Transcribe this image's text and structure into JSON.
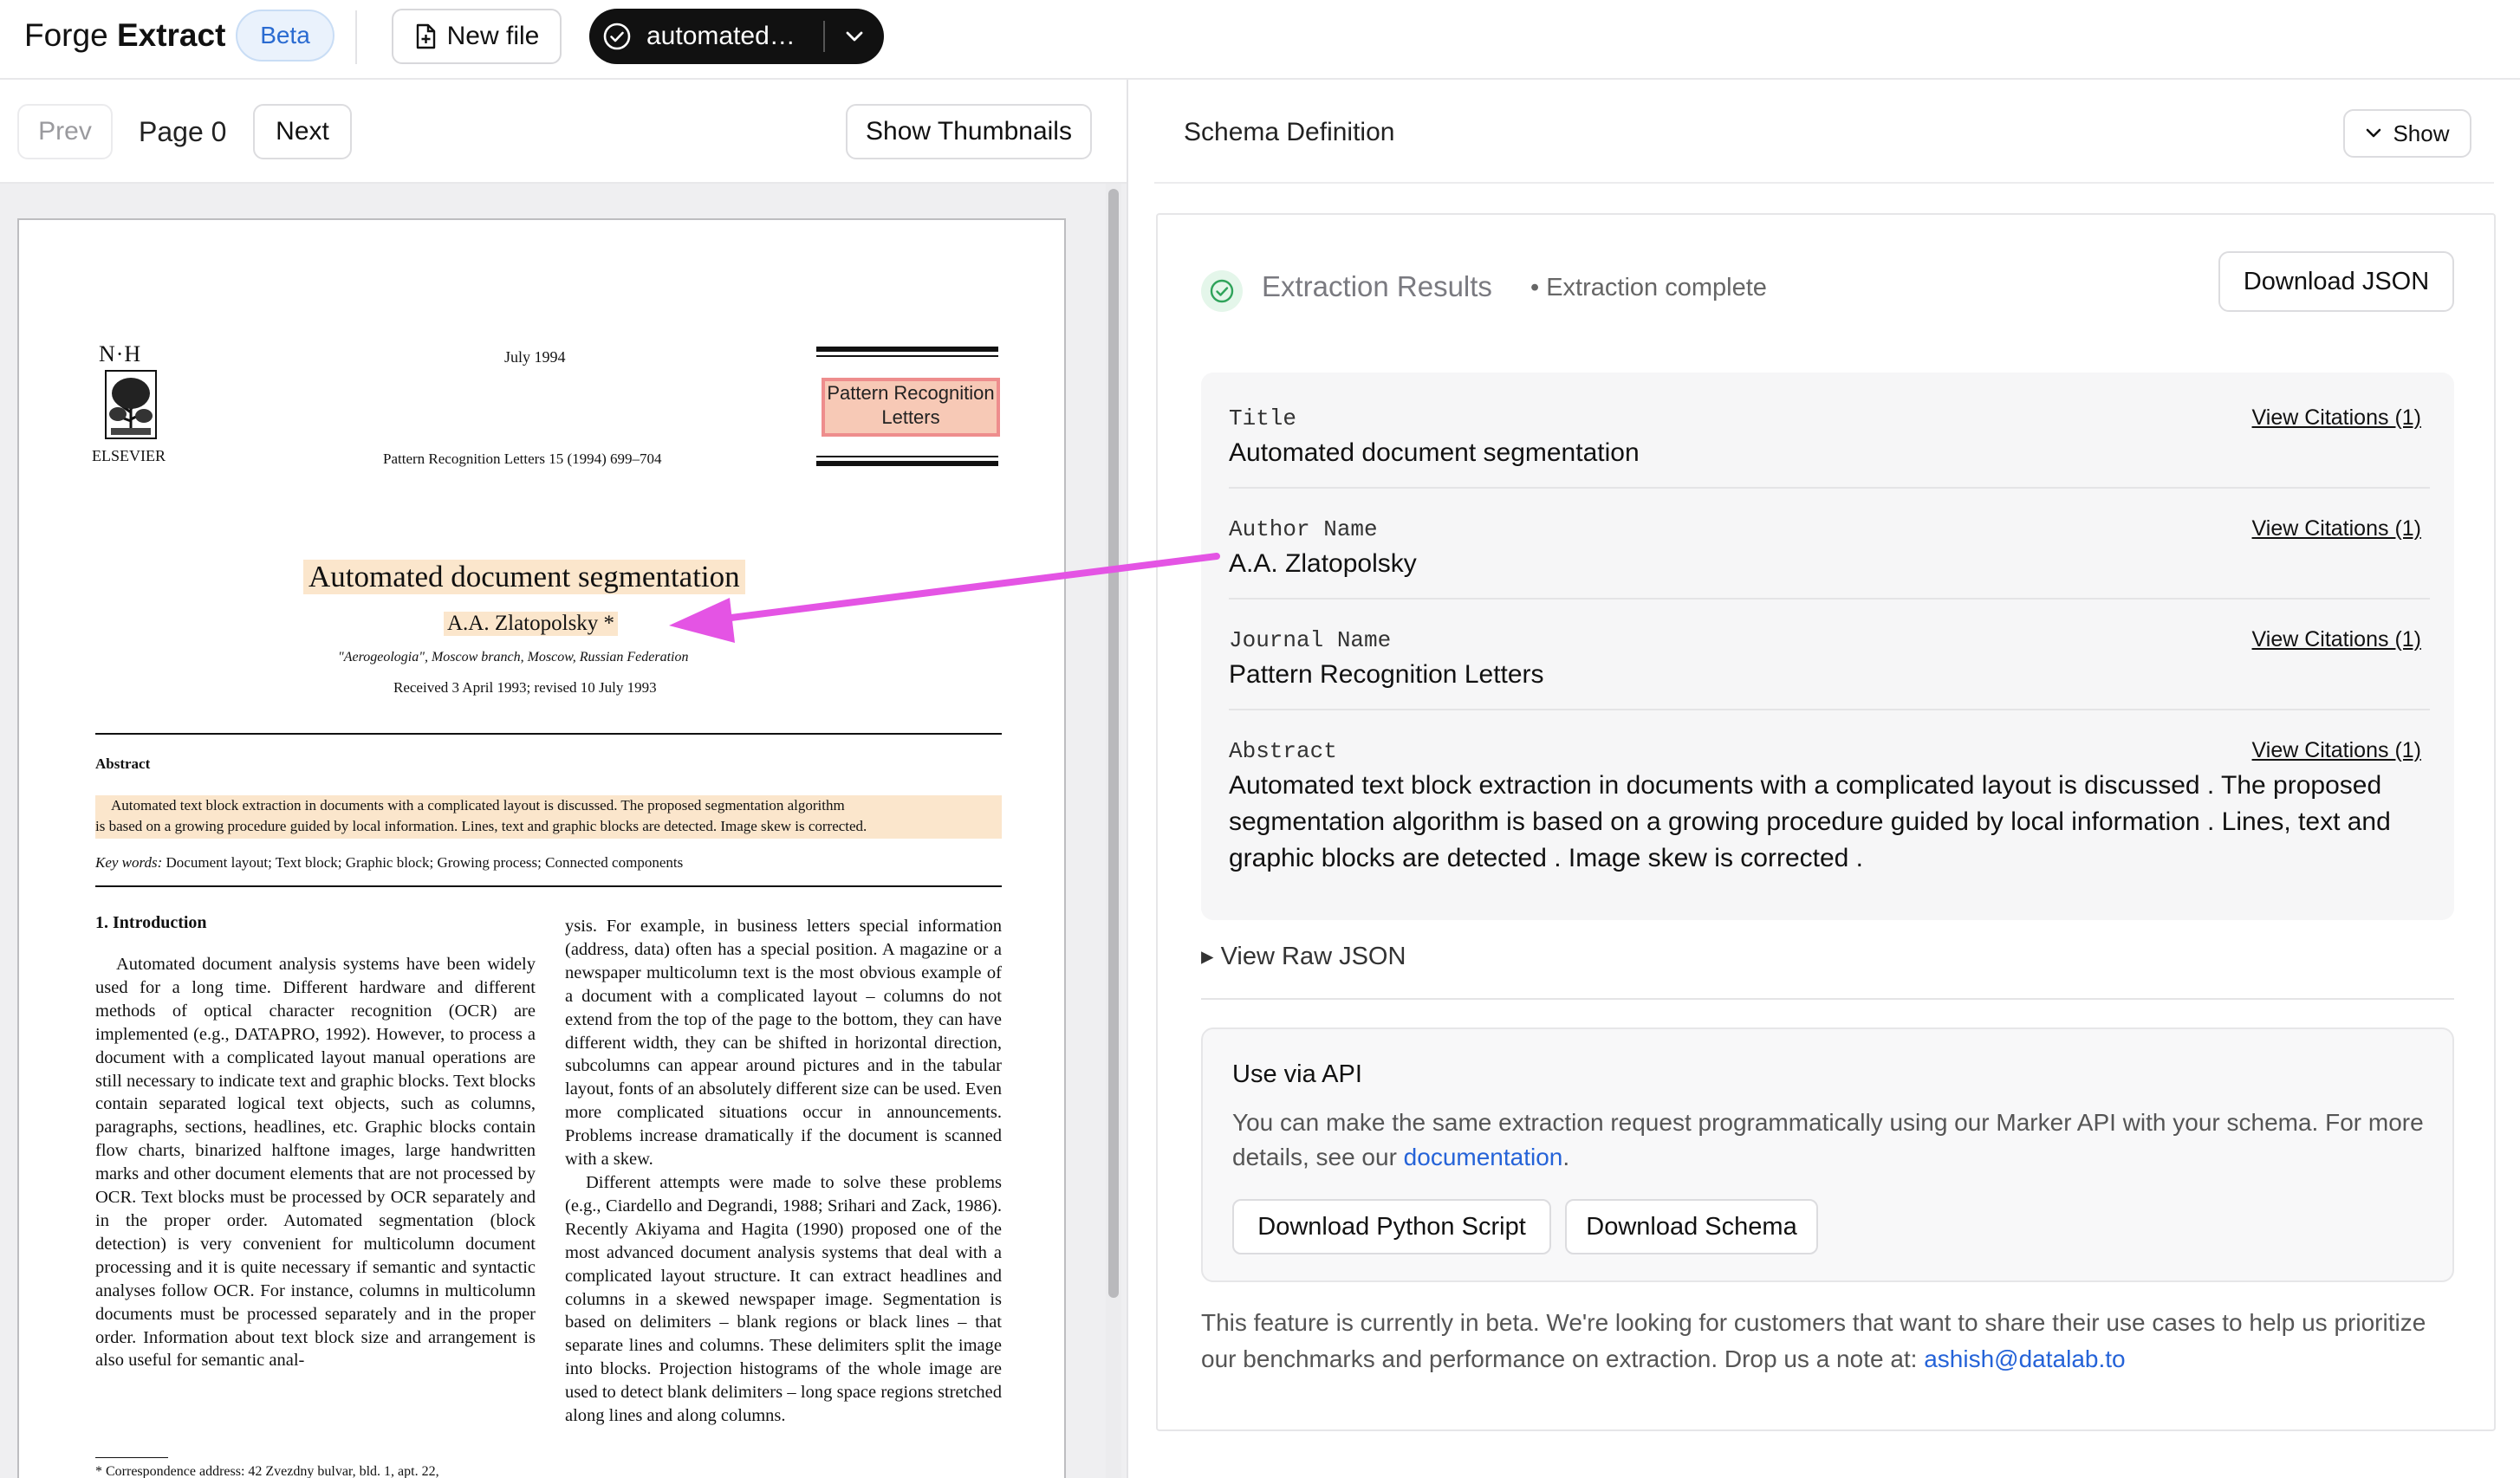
{
  "topbar": {
    "brand_plain": "Forge",
    "brand_bold": "Extract",
    "badge": "Beta",
    "new_file": "New file",
    "doc_name": "automated…"
  },
  "viewer": {
    "prev": "Prev",
    "page_label": "Page 0",
    "next": "Next",
    "thumbnails": "Show Thumbnails"
  },
  "document": {
    "publisher_mark": "N·H",
    "publisher": "ELSEVIER",
    "date": "July 1994",
    "journal_box": [
      "Pattern Recognition",
      "Letters"
    ],
    "citation": "Pattern Recognition Letters 15 (1994) 699–704",
    "title": "Automated document segmentation",
    "author": "A.A. Zlatopolsky *",
    "affiliation": "\"Aerogeologia\", Moscow branch, Moscow, Russian Federation",
    "received": "Received 3 April 1993; revised 10 July 1993",
    "abstract_heading": "Abstract",
    "abstract_lines": [
      "Automated text block extraction in documents with a complicated layout is discussed. The proposed segmentation algorithm",
      "is based on a growing procedure guided by local information. Lines, text and graphic blocks are detected. Image skew is corrected."
    ],
    "keywords_label": "Key words:",
    "keywords": "Document layout; Text block; Graphic block; Growing process; Connected components",
    "section_heading": "1. Introduction",
    "left_column": "Automated document analysis systems have been widely used for a long time. Different hardware and different methods of optical character recognition (OCR) are implemented (e.g., DATAPRO, 1992). However, to process a document with a complicated layout manual operations are still necessary to indicate text and graphic blocks. Text blocks contain separated logical text objects, such as columns, paragraphs, sections, headlines, etc. Graphic blocks contain flow charts, binarized halftone images, large handwritten marks and other document elements that are not processed by OCR. Text blocks must be processed by OCR separately and in the proper order. Automated segmentation (block detection) is very convenient for multicolumn document processing and it is quite necessary if semantic and syntactic analyses follow OCR. For instance, columns in multicolumn documents must be processed separately and in the proper order. Information about text block size and arrangement is also useful for semantic anal-",
    "right_column_p1": "ysis. For example, in business letters special information (address, data) often has a special position. A magazine or a newspaper multicolumn text is the most obvious example of a document with a complicated layout – columns do not extend from the top of the page to the bottom, they can have different width, they can be shifted in horizontal direction, subcolumns can appear around pictures and in the tabular layout, fonts of an absolutely different size can be used. Even more complicated situations occur in announcements. Problems increase dramatically if the document is scanned with a skew.",
    "right_column_p2": "Different attempts were made to solve these problems (e.g., Ciardello and Degrandi, 1988; Srihari and Zack, 1986). Recently Akiyama and Hagita (1990) proposed one of the most advanced document analysis systems that deal with a complicated layout structure. It can extract headlines and columns in a skewed newspaper image. Segmentation is based on delimiters – blank regions or black lines – that separate lines and columns. These delimiters split the image into blocks. Projection histograms of the whole image are used to detect blank delimiters – long space regions stretched along lines and along columns.",
    "footnote": "* Correspondence address: 42 Zvezdny bulvar, bld. 1, apt. 22,"
  },
  "schema": {
    "heading": "Schema Definition",
    "show": "Show"
  },
  "results": {
    "title": "Extraction Results",
    "status": "• Extraction complete",
    "download_json": "Download JSON",
    "fields": [
      {
        "label": "Title",
        "cite": "View Citations (1)",
        "value": "Automated document segmentation"
      },
      {
        "label": "Author Name",
        "cite": "View Citations (1)",
        "value": "A.A. Zlatopolsky"
      },
      {
        "label": "Journal Name",
        "cite": "View Citations (1)",
        "value": "Pattern Recognition Letters"
      },
      {
        "label": "Abstract",
        "cite": "View Citations (1)",
        "value": "Automated text block extraction in documents with a complicated layout is discussed . The proposed segmentation algorithm is based on a growing procedure guided by local information . Lines, text and graphic blocks are detected . Image skew is corrected ."
      }
    ],
    "raw_json": "▸ View Raw JSON"
  },
  "api": {
    "title": "Use via API",
    "desc": "You can make the same extraction request programmatically using our Marker API with your schema. For more details, see our",
    "doc_link": "documentation",
    "desc_end": ".",
    "btn_python": "Download Python Script",
    "btn_schema": "Download Schema"
  },
  "beta_note": {
    "text": "This feature is currently in beta. We're looking for customers that want to share their use cases to help us prioritize our benchmarks and performance on extraction. Drop us a note at:",
    "email": "ashish@datalab.to"
  },
  "colors": {
    "accent_blue": "#2563d8",
    "highlight": "#fbe6cc",
    "annotation_arrow": "#e454e4",
    "success_green": "#2fa35a"
  }
}
